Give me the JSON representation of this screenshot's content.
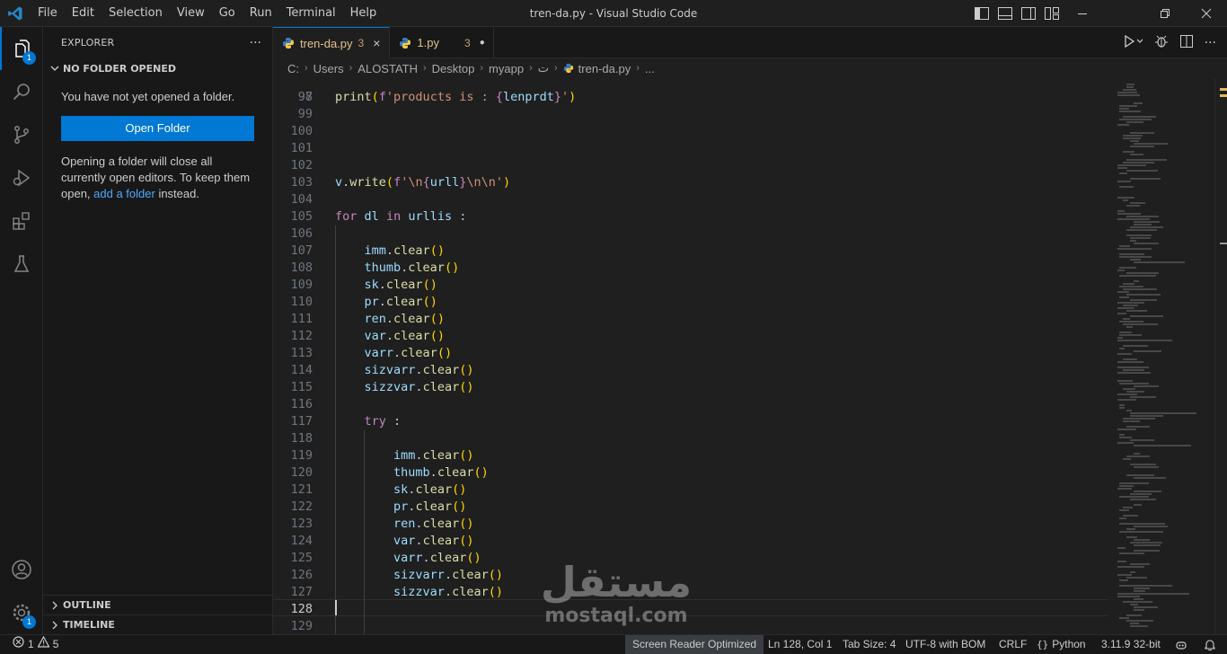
{
  "titlebar": {
    "menu": [
      "File",
      "Edit",
      "Selection",
      "View",
      "Go",
      "Run",
      "Terminal",
      "Help"
    ],
    "title": "tren-da.py - Visual Studio Code"
  },
  "activitybar": {
    "explorer_badge": "1",
    "manage_badge": "1"
  },
  "sidebar": {
    "title": "EXPLORER",
    "more": "···",
    "section": "NO FOLDER OPENED",
    "message": "You have not yet opened a folder.",
    "open_folder_label": "Open Folder",
    "info_before": "Opening a folder will close all currently open editors. To keep them open, ",
    "info_link": "add a folder",
    "info_after": " instead.",
    "outline": "OUTLINE",
    "timeline": "TIMELINE"
  },
  "tabs": [
    {
      "label": "tren-da.py",
      "count": "3",
      "close": "×"
    },
    {
      "label": "1.py",
      "count": "3",
      "dot": "●"
    }
  ],
  "breadcrumb": [
    "C:",
    "Users",
    "ALOSTATH",
    "Desktop",
    "myapp",
    "ت",
    "tren-da.py",
    "..."
  ],
  "editor": {
    "first_line_partial": "97",
    "lines": [
      {
        "n": "98",
        "text": "print(f'products is : {lenprdt}')"
      },
      {
        "n": "99",
        "text": ""
      },
      {
        "n": "100",
        "text": ""
      },
      {
        "n": "101",
        "text": ""
      },
      {
        "n": "102",
        "text": ""
      },
      {
        "n": "103",
        "text": "v.write(f'\\n{urll}\\n\\n')"
      },
      {
        "n": "104",
        "text": ""
      },
      {
        "n": "105",
        "text": "for dl in urllis :"
      },
      {
        "n": "106",
        "text": ""
      },
      {
        "n": "107",
        "text": "    imm.clear()"
      },
      {
        "n": "108",
        "text": "    thumb.clear()"
      },
      {
        "n": "109",
        "text": "    sk.clear()"
      },
      {
        "n": "110",
        "text": "    pr.clear()"
      },
      {
        "n": "111",
        "text": "    ren.clear()"
      },
      {
        "n": "112",
        "text": "    var.clear()"
      },
      {
        "n": "113",
        "text": "    varr.clear()"
      },
      {
        "n": "114",
        "text": "    sizvarr.clear()"
      },
      {
        "n": "115",
        "text": "    sizzvar.clear()"
      },
      {
        "n": "116",
        "text": ""
      },
      {
        "n": "117",
        "text": "    try :"
      },
      {
        "n": "118",
        "text": ""
      },
      {
        "n": "119",
        "text": "        imm.clear()"
      },
      {
        "n": "120",
        "text": "        thumb.clear()"
      },
      {
        "n": "121",
        "text": "        sk.clear()"
      },
      {
        "n": "122",
        "text": "        pr.clear()"
      },
      {
        "n": "123",
        "text": "        ren.clear()"
      },
      {
        "n": "124",
        "text": "        var.clear()"
      },
      {
        "n": "125",
        "text": "        varr.clear()"
      },
      {
        "n": "126",
        "text": "        sizvarr.clear()"
      },
      {
        "n": "127",
        "text": "        sizzvar.clear()"
      },
      {
        "n": "128",
        "text": ""
      },
      {
        "n": "129",
        "text": ""
      }
    ],
    "current_line": "128"
  },
  "statusbar": {
    "errors": "1",
    "warnings": "5",
    "screen_reader": "Screen Reader Optimized",
    "position": "Ln 128, Col 1",
    "tab_size": "Tab Size: 4",
    "encoding": "UTF-8 with BOM",
    "eol": "CRLF",
    "language": "Python",
    "interpreter": "3.11.9 32-bit"
  },
  "watermark": {
    "arabic": "مستقل",
    "latin": "mostaql.com"
  },
  "colors": {
    "accent": "#0078d4",
    "background": "#1f1f1f",
    "sidebar": "#181818",
    "keyword": "#c586c0",
    "function": "#dcdcaa",
    "variable": "#9cdcfe",
    "string": "#ce9178",
    "bracket": "#ffd700",
    "modified_tab": "#e2c08d"
  }
}
